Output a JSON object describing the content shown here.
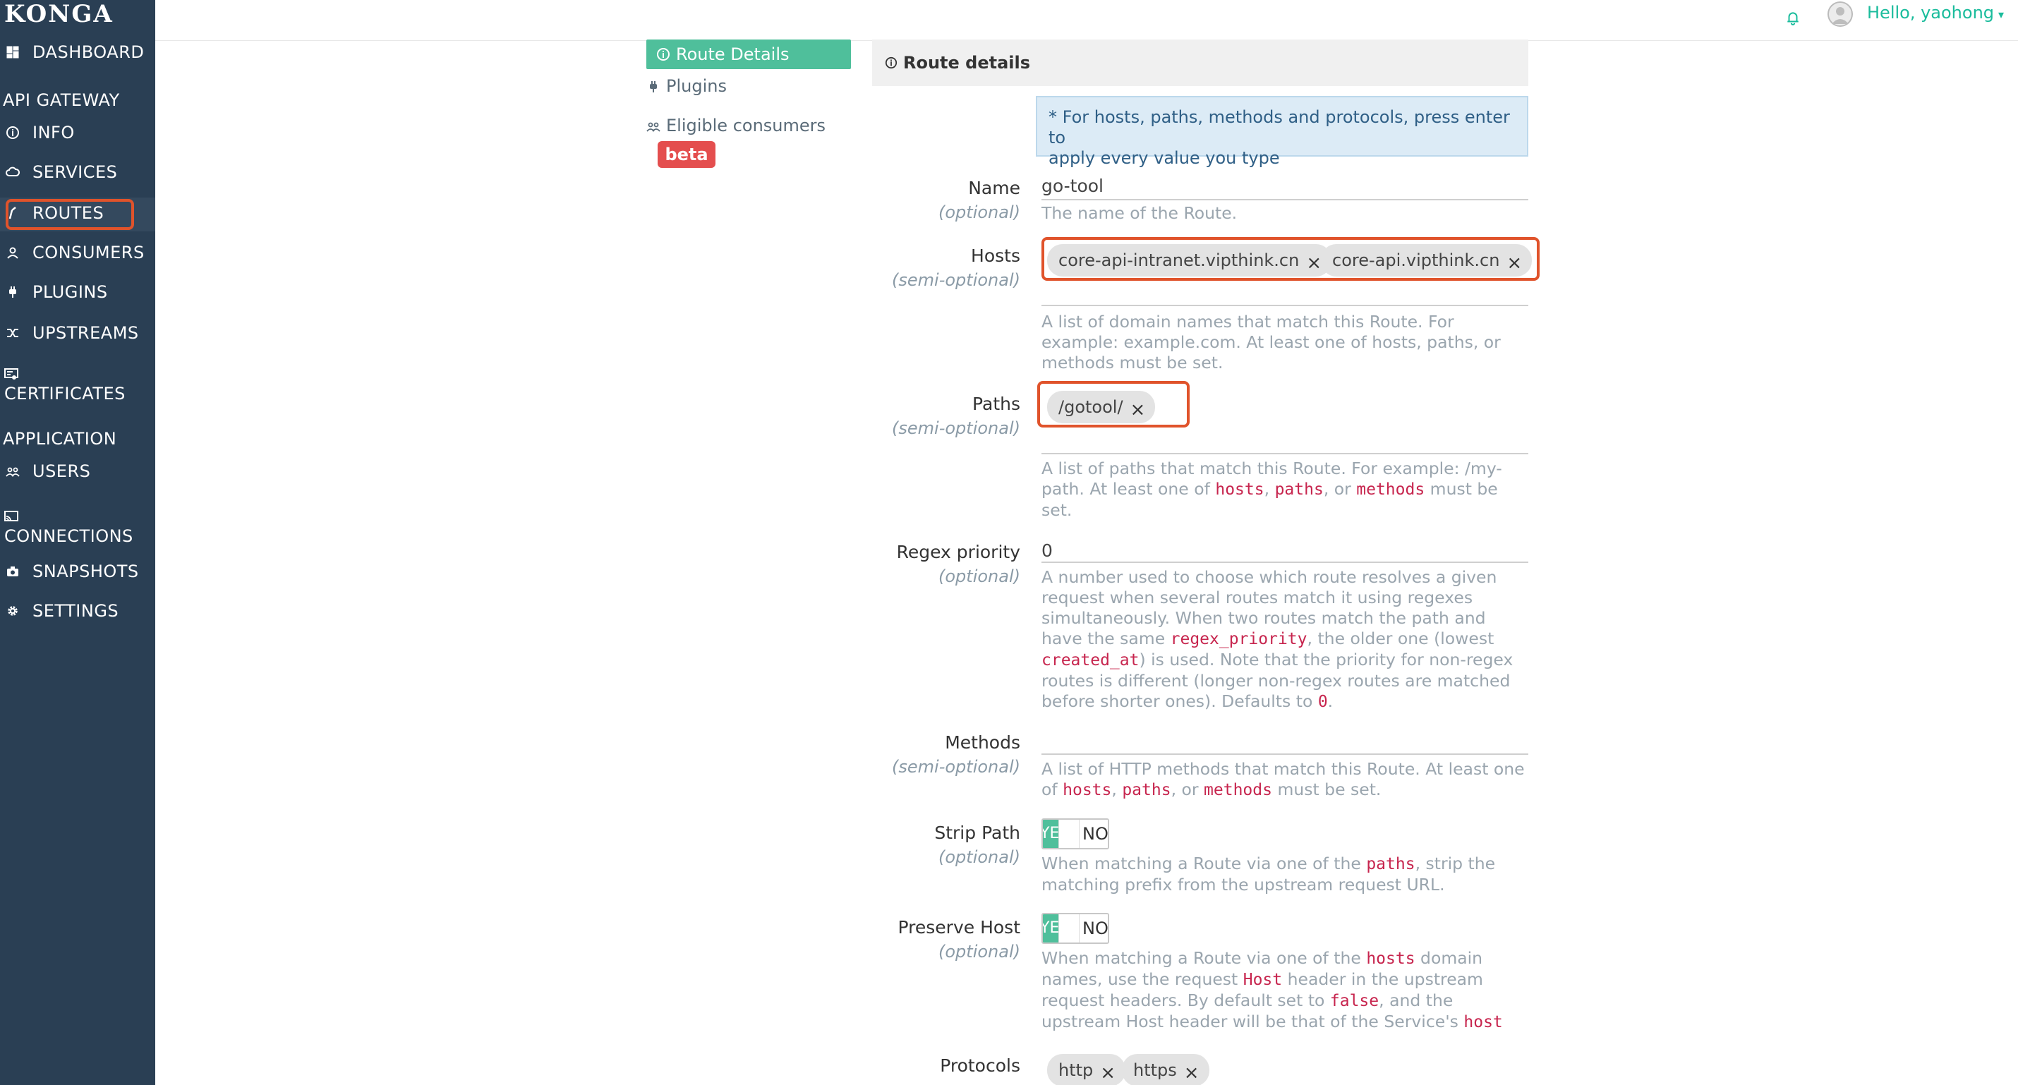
{
  "app": {
    "logo": "KONGA"
  },
  "sidebar": {
    "dashboard": "DASHBOARD",
    "api_gateway_header": "API GATEWAY",
    "info": "INFO",
    "services": "SERVICES",
    "routes": "ROUTES",
    "consumers": "CONSUMERS",
    "plugins": "PLUGINS",
    "upstreams": "UPSTREAMS",
    "certificates": "CERTIFICATES",
    "application_header": "APPLICATION",
    "users": "USERS",
    "connections": "CONNECTIONS",
    "snapshots": "SNAPSHOTS",
    "settings": "SETTINGS"
  },
  "topbar": {
    "greeting": "Hello, yaohong"
  },
  "tabs": {
    "route_details": "Route Details",
    "plugins": "Plugins",
    "eligible_consumers": "Eligible consumers",
    "beta": "beta"
  },
  "panel": {
    "heading": "Route details",
    "info_line1": "* For hosts, paths, methods and protocols, press enter to",
    "info_line2": "apply every value you type"
  },
  "form": {
    "name": {
      "label": "Name",
      "sub": "(optional)",
      "value": "go-tool",
      "help": "The name of the Route."
    },
    "hosts": {
      "label": "Hosts",
      "sub": "(semi-optional)",
      "chips": [
        "core-api-intranet.vipthink.cn",
        "core-api.vipthink.cn"
      ],
      "help1": "A list of domain names that match this Route. For",
      "help2": "example: example.com. At least one of hosts, paths, or",
      "help3": "methods must be set."
    },
    "paths": {
      "label": "Paths",
      "sub": "(semi-optional)",
      "chips": [
        "/gotool/"
      ],
      "help1": "A list of paths that match this Route. For example: /my-",
      "help2a": "path. At least one of ",
      "code_hosts": "hosts",
      "comma": ", ",
      "code_paths": "paths",
      "or": ", or ",
      "code_methods": "methods",
      "help2b": " must be",
      "help3": "set."
    },
    "regex": {
      "label": "Regex priority",
      "sub": "(optional)",
      "value": "0",
      "l1": "A number used to choose which route resolves a given",
      "l2": "request when several routes match it using regexes",
      "l3": "simultaneously. When two routes match the path and",
      "l4a": "have the same ",
      "l4code": "regex_priority",
      "l4b": ", the older one (lowest",
      "l5code": "created_at",
      "l5b": ") is used. Note that the priority for non-regex",
      "l6": "routes is different (longer non-regex routes are matched",
      "l7a": "before shorter ones). Defaults to ",
      "l7code": "0",
      "l7b": "."
    },
    "methods": {
      "label": "Methods",
      "sub": "(semi-optional)",
      "l1": "A list of HTTP methods that match this Route. At least one",
      "l2a": "of ",
      "code_hosts": "hosts",
      "comma": ", ",
      "code_paths": "paths",
      "or": ", or ",
      "code_methods": "methods",
      "l2b": " must be set."
    },
    "strip_path": {
      "label": "Strip Path",
      "sub": "(optional)",
      "on_text": "YES",
      "off_text": "NO",
      "l1a": "When matching a Route via one of the ",
      "l1code": "paths",
      "l1b": ", strip the",
      "l2": "matching prefix from the upstream request URL."
    },
    "preserve_host": {
      "label": "Preserve Host",
      "sub": "(optional)",
      "on_text": "YES",
      "off_text": "NO",
      "l1a": "When matching a Route via one of the ",
      "l1code": "hosts",
      "l1b": " domain",
      "l2a": "names, use the request ",
      "l2code": "Host",
      "l2b": " header in the upstream",
      "l3a": "request headers. By default set to ",
      "l3code": "false",
      "l3b": ", and the",
      "l4a": "upstream Host header will be that of the Service's ",
      "l4code": "host"
    },
    "protocols": {
      "label": "Protocols",
      "chips": [
        "http",
        "https"
      ]
    }
  },
  "colors": {
    "sidebar_bg": "#2a3f54",
    "accent": "#4fbf9b",
    "highlight": "#e0532b",
    "code": "#c7254e",
    "beta": "#e44e4e"
  }
}
